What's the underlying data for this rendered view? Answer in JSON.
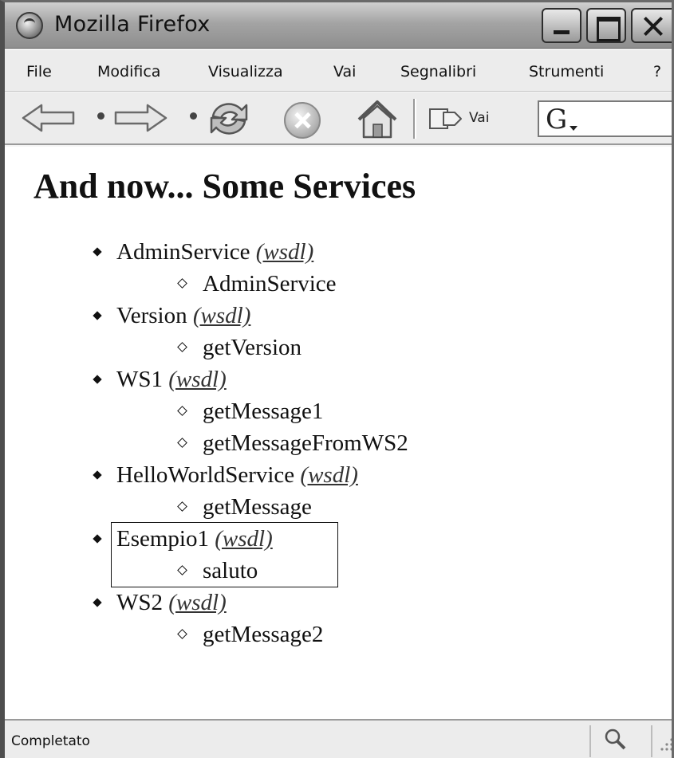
{
  "window": {
    "title": "Mozilla Firefox"
  },
  "menu": {
    "items": [
      {
        "label": "File"
      },
      {
        "label": "Modifica"
      },
      {
        "label": "Visualizza"
      },
      {
        "label": "Vai"
      },
      {
        "label": "Segnalibri"
      },
      {
        "label": "Strumenti"
      },
      {
        "label": "?"
      }
    ]
  },
  "toolbar": {
    "go_label": "Vai",
    "search_logo": "G",
    "search_value": "",
    "icons": [
      "back-arrow-icon",
      "forward-arrow-icon",
      "reload-icon",
      "stop-icon",
      "home-icon",
      "go-icon",
      "google-search-icon"
    ]
  },
  "page": {
    "heading": "And now... Some Services",
    "wsdl_label": "(wsdl)",
    "services": [
      {
        "name": "AdminService",
        "operations": [
          "AdminService"
        ]
      },
      {
        "name": "Version",
        "operations": [
          "getVersion"
        ]
      },
      {
        "name": "WS1",
        "operations": [
          "getMessage1",
          "getMessageFromWS2"
        ]
      },
      {
        "name": "HelloWorldService",
        "operations": [
          "getMessage"
        ]
      },
      {
        "name": "Esempio1",
        "operations": [
          "saluto"
        ],
        "boxed": true
      },
      {
        "name": "WS2",
        "operations": [
          "getMessage2"
        ]
      }
    ]
  },
  "status": {
    "text": "Completato"
  }
}
